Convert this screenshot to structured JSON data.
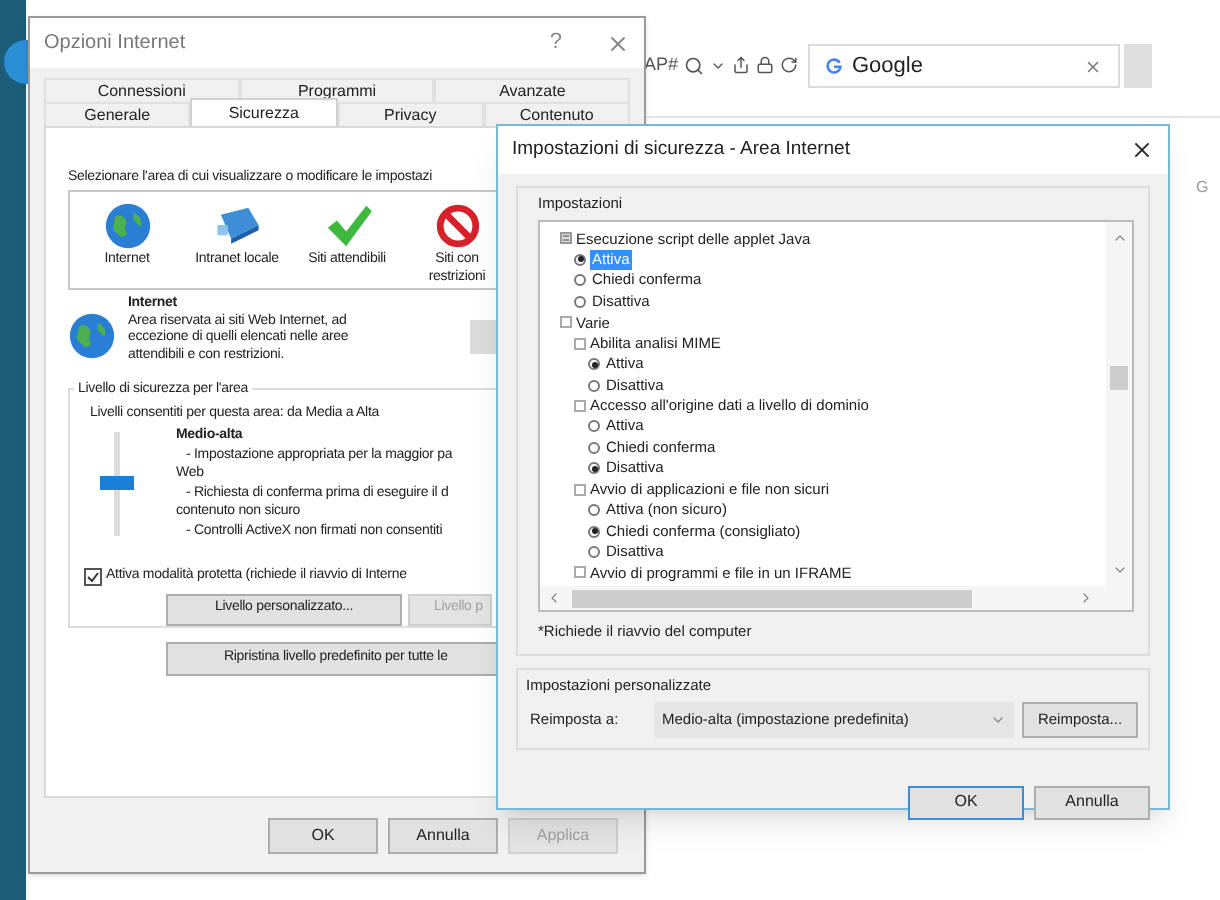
{
  "browser": {
    "address_fragment": "AP#",
    "tab_title": "Google",
    "side_letter": "G"
  },
  "options_window": {
    "title": "Opzioni Internet",
    "help": "?",
    "tab_rows": [
      {
        "tabs": [
          {
            "label": "Connessioni",
            "selected": false
          },
          {
            "label": "Programmi",
            "selected": false
          },
          {
            "label": "Avanzate",
            "selected": false
          }
        ]
      },
      {
        "tabs": [
          {
            "label": "Generale",
            "selected": false
          },
          {
            "label": "Sicurezza",
            "selected": true
          },
          {
            "label": "Privacy",
            "selected": false
          },
          {
            "label": "Contenuto",
            "selected": false
          }
        ]
      }
    ],
    "zone_prompt": "Selezionare l'area di cui visualizzare o modificare le impostazi",
    "zones": [
      {
        "label": "Internet",
        "kind": "globe"
      },
      {
        "label": "Intranet locale",
        "kind": "intranet"
      },
      {
        "label": "Siti attendibili",
        "kind": "trusted"
      },
      {
        "label": "Siti con restrizioni",
        "kind": "restricted"
      }
    ],
    "zone_info": {
      "title": "Internet",
      "description": "Area riservata ai siti Web Internet, ad eccezione di quelli elencati nelle aree attendibili e con restrizioni."
    },
    "level_group": {
      "title": "Livello di sicurezza per l'area",
      "allowed": "Livelli consentiti per questa area: da Media a Alta",
      "level": 0.5,
      "level_name": "Medio-alta",
      "lines": [
        {
          "text": "- Impostazione appropriata per la maggior pa",
          "kind": "bullet"
        },
        {
          "text": "Web",
          "kind": "continuation"
        },
        {
          "text": "- Richiesta di conferma prima di eseguire il d",
          "kind": "bullet"
        },
        {
          "text": "contenuto non sicuro",
          "kind": "continuation"
        },
        {
          "text": "- Controlli ActiveX non firmati non consentiti",
          "kind": "bullet"
        }
      ]
    },
    "protected_mode": {
      "label": "Attiva modalità protetta (richiede il riavvio di Interne",
      "checked": true
    },
    "level_buttons": [
      {
        "label": "Livello personalizzato...",
        "disabled": false
      },
      {
        "label": "Livello p",
        "disabled": true
      }
    ],
    "reset_all_button": "Ripristina livello predefinito per tutte le",
    "footer_buttons": [
      {
        "label": "OK",
        "disabled": false
      },
      {
        "label": "Annulla",
        "disabled": false
      },
      {
        "label": "Applica",
        "disabled": true
      }
    ]
  },
  "security_dialog": {
    "title": "Impostazioni di sicurezza - Area Internet",
    "settings_label": "Impostazioni",
    "tree": [
      {
        "label": "Esecuzione script delle applet Java",
        "kind": "setting",
        "children": [
          {
            "label": "Attiva",
            "kind": "option",
            "selected": true,
            "focused": true
          },
          {
            "label": "Chiedi conferma",
            "kind": "option",
            "selected": false,
            "focused": false
          },
          {
            "label": "Disattiva",
            "kind": "option",
            "selected": false,
            "focused": false
          }
        ]
      },
      {
        "label": "Varie",
        "kind": "category",
        "children": [
          {
            "label": "Abilita analisi MIME",
            "kind": "category",
            "children": [
              {
                "label": "Attiva",
                "kind": "option",
                "selected": true,
                "focused": false
              },
              {
                "label": "Disattiva",
                "kind": "option",
                "selected": false,
                "focused": false
              }
            ]
          },
          {
            "label": "Accesso all'origine dati a livello di dominio",
            "kind": "category",
            "children": [
              {
                "label": "Attiva",
                "kind": "option",
                "selected": false,
                "focused": false
              },
              {
                "label": "Chiedi conferma",
                "kind": "option",
                "selected": false,
                "focused": false
              },
              {
                "label": "Disattiva",
                "kind": "option",
                "selected": true,
                "focused": false
              }
            ]
          },
          {
            "label": "Avvio di applicazioni e file non sicuri",
            "kind": "category",
            "children": [
              {
                "label": "Attiva (non sicuro)",
                "kind": "option",
                "selected": false,
                "focused": false
              },
              {
                "label": "Chiedi conferma (consigliato)",
                "kind": "option",
                "selected": true,
                "focused": false
              },
              {
                "label": "Disattiva",
                "kind": "option",
                "selected": false,
                "focused": false
              }
            ]
          },
          {
            "label": "Avvio di programmi e file in un IFRAME",
            "kind": "category"
          }
        ]
      }
    ],
    "restart_note": "*Richiede il riavvio del computer",
    "custom_label": "Impostazioni personalizzate",
    "reset_label": "Reimposta a:",
    "reset_value": "Medio-alta (impostazione predefinita)",
    "reset_button": "Reimposta...",
    "buttons": [
      {
        "label": "OK",
        "default": true
      },
      {
        "label": "Annulla",
        "default": false
      }
    ]
  }
}
